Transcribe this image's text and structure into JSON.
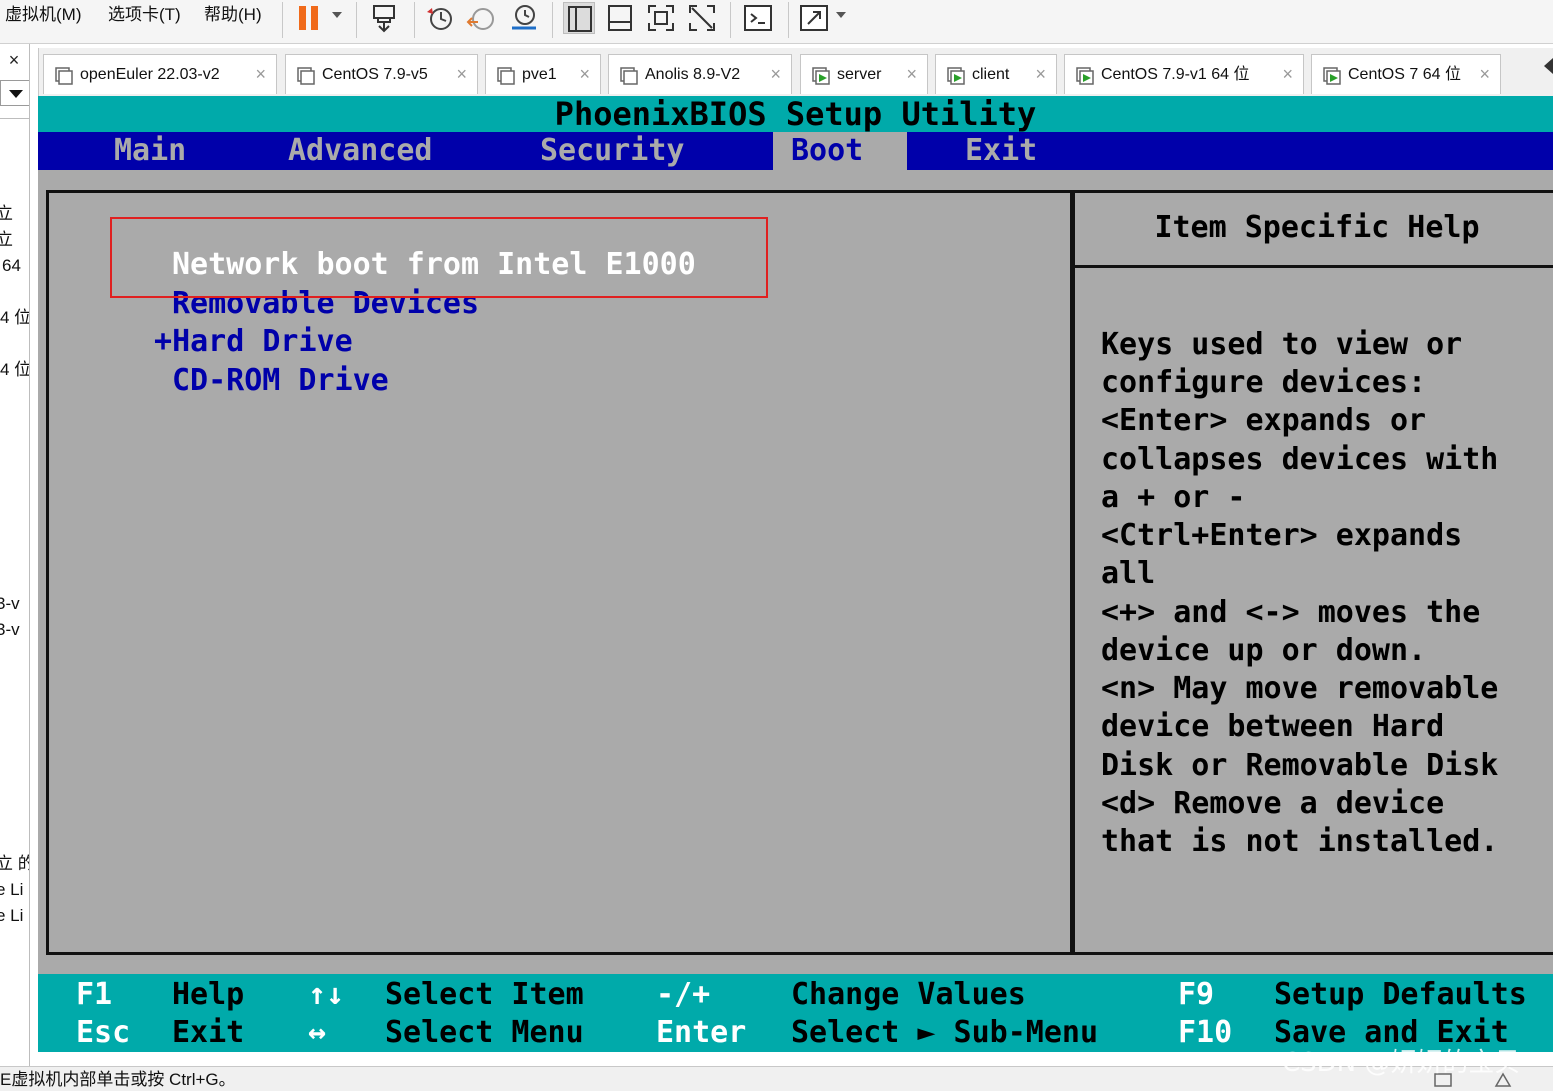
{
  "toolbar": {
    "menus": [
      "虚拟机(M)",
      "选项卡(T)",
      "帮助(H)"
    ],
    "icons": [
      "pause-icon",
      "send-ctrl-alt-del-icon",
      "snapshot-icon",
      "revert-snapshot-icon",
      "snapshot-manager-icon",
      "single-window-icon",
      "console-view-icon",
      "fullscreen-icon",
      "unity-icon",
      "terminal-icon",
      "stretch-icon"
    ]
  },
  "sidebar": {
    "close": "×",
    "fragments": [
      "立",
      "立",
      "64",
      "4 位",
      "4 位",
      "3-v",
      "3-v",
      "立 的",
      "e Li",
      "e Li"
    ]
  },
  "tabs": [
    {
      "label": "openEuler 22.03-v2",
      "icon": "vm-off-icon"
    },
    {
      "label": "CentOS 7.9-v5",
      "icon": "vm-off-icon"
    },
    {
      "label": "pve1",
      "icon": "vm-off-icon"
    },
    {
      "label": "Anolis 8.9-V2",
      "icon": "vm-off-icon"
    },
    {
      "label": "server",
      "icon": "vm-running-icon"
    },
    {
      "label": "client",
      "icon": "vm-running-icon"
    },
    {
      "label": "CentOS 7.9-v1 64 位",
      "icon": "vm-running-icon"
    },
    {
      "label": "CentOS 7 64 位",
      "icon": "vm-running-icon"
    }
  ],
  "tab_close": "×",
  "bios": {
    "title": "PhoenixBIOS Setup Utility",
    "menu": [
      "Main",
      "Advanced",
      "Security",
      "Boot",
      "Exit"
    ],
    "active_menu": "Boot",
    "boot_items": [
      {
        "label": "Network boot from Intel E1000",
        "prefix": "",
        "selected": true
      },
      {
        "label": "Removable Devices",
        "prefix": "",
        "selected": false
      },
      {
        "label": "Hard Drive",
        "prefix": "+",
        "selected": false
      },
      {
        "label": "CD-ROM Drive",
        "prefix": "",
        "selected": false
      }
    ],
    "help_title": "Item Specific Help",
    "help_lines": [
      "Keys used to view or",
      "configure devices:",
      "<Enter> expands or",
      "collapses devices with",
      "a + or -",
      "<Ctrl+Enter> expands",
      "all",
      "<+> and <-> moves the",
      "device up or down.",
      "<n> May move removable",
      "device between Hard",
      "Disk or Removable Disk",
      "<d> Remove a device",
      "that is not installed."
    ],
    "footer": {
      "row1": [
        {
          "key": "F1",
          "desc": "Help"
        },
        {
          "key": "↑↓",
          "desc": "Select Item"
        },
        {
          "key": "-/+",
          "desc": "Change Values"
        },
        {
          "key": "F9",
          "desc": "Setup Defaults"
        }
      ],
      "row2": [
        {
          "key": "Esc",
          "desc": "Exit"
        },
        {
          "key": "↔",
          "desc": "Select Menu"
        },
        {
          "key": "Enter",
          "desc": "Select ► Sub-Menu"
        },
        {
          "key": "F10",
          "desc": "Save and Exit"
        }
      ]
    },
    "colors": {
      "cyan": "#00aaaa",
      "blue": "#0000aa",
      "gray": "#aaaaaa",
      "white": "#ffffff",
      "highlight": "#e02020"
    }
  },
  "status": {
    "text": "E虚拟机内部单击或按 Ctrl+G。",
    "watermark": "CSDN @妍妍的宝贝"
  }
}
